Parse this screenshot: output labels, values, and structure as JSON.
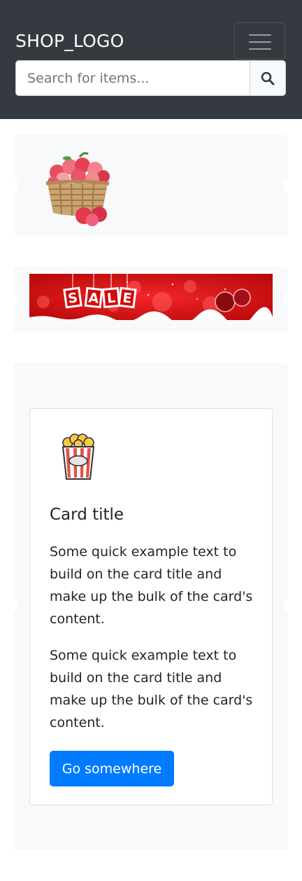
{
  "navbar": {
    "brand": "SHOP_LOGO",
    "search_placeholder": "Search for items..."
  },
  "icons": {
    "search": "search-icon",
    "menu": "hamburger-menu-icon",
    "carousel_prev": "chevron-left-icon",
    "carousel_next": "chevron-right-icon"
  },
  "carousels": [
    {
      "image": "apple-basket-icon"
    },
    {
      "image": "sale-banner"
    },
    {
      "image": "popcorn-icon"
    }
  ],
  "sale_banner": {
    "letters": [
      "S",
      "A",
      "L",
      "E"
    ]
  },
  "card": {
    "title": "Card title",
    "text1": "Some quick example text to build on the card title and make up the bulk of the card's content.",
    "text2": "Some quick example text to build on the card title and make up the bulk of the card's content.",
    "button_label": "Go somewhere"
  },
  "colors": {
    "navbar_bg": "#343a40",
    "panel_bg": "#f8f9fa",
    "primary": "#007bff",
    "sale_red": "#d10a0a"
  }
}
